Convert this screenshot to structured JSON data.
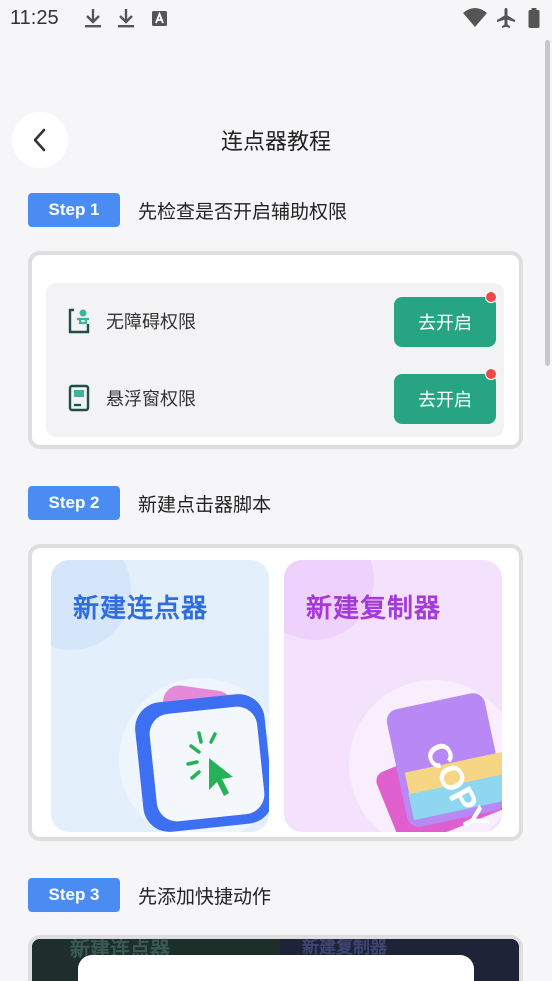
{
  "status_bar": {
    "time": "11:25",
    "icons": [
      "download-icon",
      "download-icon",
      "font-a-icon",
      "wifi-icon",
      "airplane-icon",
      "battery-icon"
    ]
  },
  "header": {
    "back_icon": "chevron-left-icon",
    "title": "连点器教程"
  },
  "steps": [
    {
      "badge": "Step 1",
      "text": "先检查是否开启辅助权限"
    },
    {
      "badge": "Step 2",
      "text": "新建点击器脚本"
    },
    {
      "badge": "Step 3",
      "text": "先添加快捷动作"
    }
  ],
  "permissions": [
    {
      "icon": "accessibility-icon",
      "label": "无障碍权限",
      "button": "去开启"
    },
    {
      "icon": "floating-window-icon",
      "label": "悬浮窗权限",
      "button": "去开启"
    }
  ],
  "cards": [
    {
      "title": "新建连点器",
      "icon": "click-cursor-icon"
    },
    {
      "title": "新建复制器",
      "icon": "copy-cards-icon",
      "art_text": "COPY"
    }
  ],
  "step3_preview": {
    "left_text": "新建连点器",
    "right_text": "新建复制器"
  },
  "colors": {
    "step_badge": "#4a8cf2",
    "open_button": "#27a583",
    "notify_dot": "#ec4a4a",
    "card1_title": "#2f6ee0",
    "card2_title": "#a43ad8"
  }
}
